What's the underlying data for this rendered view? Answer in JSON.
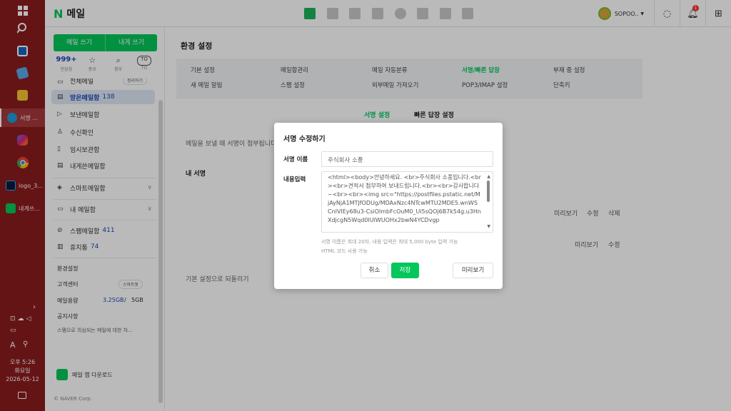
{
  "taskbar": {
    "apps": [
      {
        "label": "서명 ...",
        "color": "#1e9bd7"
      },
      {
        "label": "logo_3...",
        "color": "#0a1a3a"
      },
      {
        "label": "내게쓰...",
        "color": "#03c75a"
      }
    ],
    "clock": {
      "time": "오후 5:26",
      "day": "화요일",
      "date": "2026-05-12"
    }
  },
  "header": {
    "logo_letter": "N",
    "logo_text": "메일",
    "user_name": "SOPOO..",
    "notification_count": "1"
  },
  "sidebar": {
    "write_mail": "메일 쓰기",
    "write_self": "내게 쓰기",
    "quick": [
      {
        "value": "999+",
        "label": "안읽음"
      },
      {
        "icon": "☆",
        "label": "중요"
      },
      {
        "icon": "⌕",
        "label": "첨부"
      },
      {
        "icon": "TO",
        "label": "TO"
      }
    ],
    "all_mail": "전체메일",
    "all_mail_pill": "정리하기",
    "inbox": "받은메일함",
    "inbox_count": "138",
    "sent": "보낸메일함",
    "receipt": "수신확인",
    "draft": "임시보관함",
    "to_me": "내게쓴메일함",
    "smart": "스마트메일함",
    "my_box": "내 메일함",
    "spam": "스팸메일함",
    "spam_count": "411",
    "trash": "휴지통",
    "trash_count": "74",
    "settings": "환경설정",
    "support": "고객센터",
    "smartbot": "스마트봇",
    "capacity_label": "메일용량",
    "capacity_used": "3.25GB",
    "capacity_sep": "/",
    "capacity_total": "5GB",
    "notice_title": "공지사항",
    "notice_text": "스팸으로 의심되는 메일에 대한 차...",
    "app_download": "메일 앱 다운로드",
    "copyright": "© NAVER Corp."
  },
  "main": {
    "title": "환경 설정",
    "tabs_row1": [
      "기본 설정",
      "메일함관리",
      "메일 자동분류",
      "서명/빠른 답장",
      "부재 중 설정"
    ],
    "tabs_row2": [
      "새 메일 알림",
      "스팸 설정",
      "외부메일 가져오기",
      "POP3/IMAP 설정",
      "단축키"
    ],
    "subtab_active": "서명 설정",
    "subtab_other": "빠른 답장 설정",
    "desc": "메일을 보낼 때 서명이 첨부됩니다.",
    "my_sig": "내 서명",
    "row1_actions": [
      "미리보기",
      "수정",
      "삭제"
    ],
    "row2_actions": [
      "미리보기",
      "수정"
    ],
    "reset": "기본 설정으로 되돌리기"
  },
  "modal": {
    "title": "서명 수정하기",
    "name_label": "서명 이름",
    "name_value": "주식회사 소풍",
    "content_label": "내용입력",
    "content_value": "<html><body>안녕하세요. <br>주식회사 소풍입니다.<br><br>견적서 첨부하여 보내드립니다.<br><br>감사합니다~<br><br><img src=\"https://postfiles.pstatic.net/MjAyNjA1MTJfODUg/MDAxNzc4NTcwMTU2MDE5.wnWSCnIVlEy68u3-CsiOlmbFcOuM0_Ui5sQOj6B7k54g.u3HnXdjcgN5Wqd0lUIWUOHx2bwN4YCDvgp",
    "help_line1": "서명 이름은 최대 20자, 내용 입력은 최대 5,000 byte 입력 가능",
    "help_line2": "HTML 코드 사용 가능",
    "cancel": "취소",
    "save": "저장",
    "preview": "미리보기"
  },
  "colors": {
    "naver_green": "#03c75a",
    "taskbar": "#8b1c1f",
    "link_blue": "#1a47b8"
  }
}
